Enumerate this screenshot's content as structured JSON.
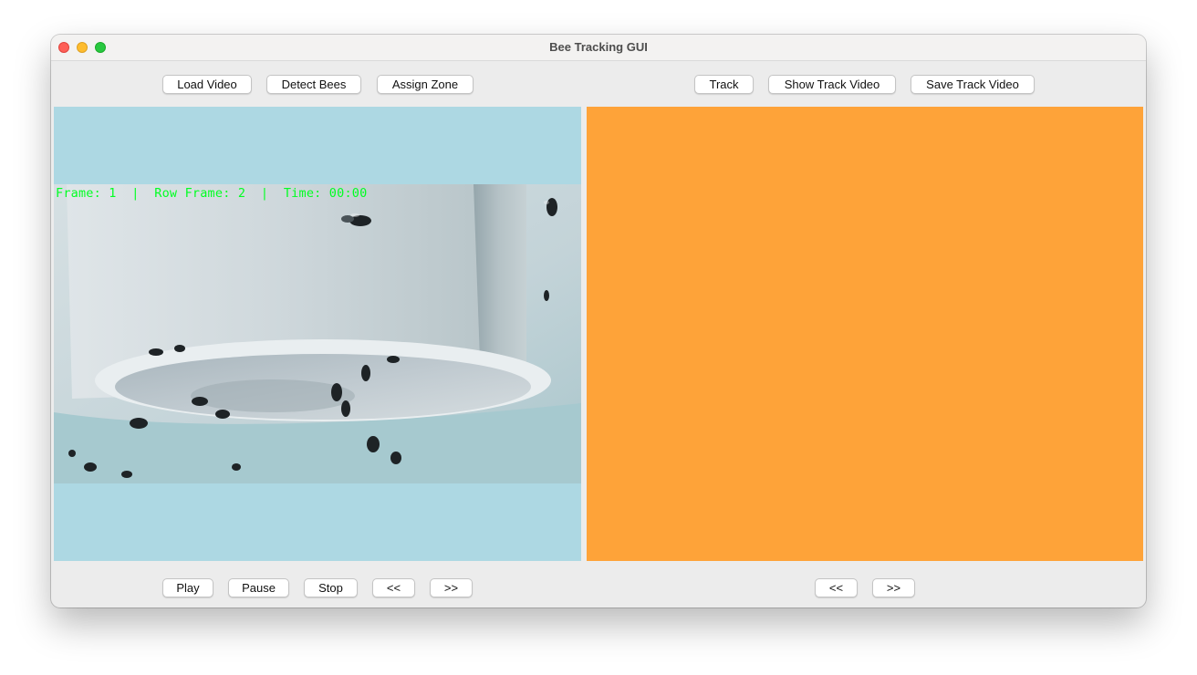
{
  "window": {
    "title": "Bee Tracking GUI"
  },
  "toolbar_left": {
    "load_video": "Load Video",
    "detect_bees": "Detect Bees",
    "assign_zone": "Assign Zone"
  },
  "toolbar_right": {
    "track": "Track",
    "show_track_video": "Show Track Video",
    "save_track_video": "Save Track Video"
  },
  "video_overlay": {
    "text": "Frame: 1  |  Row Frame: 2  |  Time: 00:00",
    "color": "#00ff22"
  },
  "playback_left": {
    "play": "Play",
    "pause": "Pause",
    "stop": "Stop",
    "prev": "<<",
    "next": ">>"
  },
  "playback_right": {
    "prev": "<<",
    "next": ">>"
  },
  "colors": {
    "left_panel_bg": "#add8e3",
    "right_panel_bg": "#fea339",
    "window_bg": "#ececec"
  }
}
